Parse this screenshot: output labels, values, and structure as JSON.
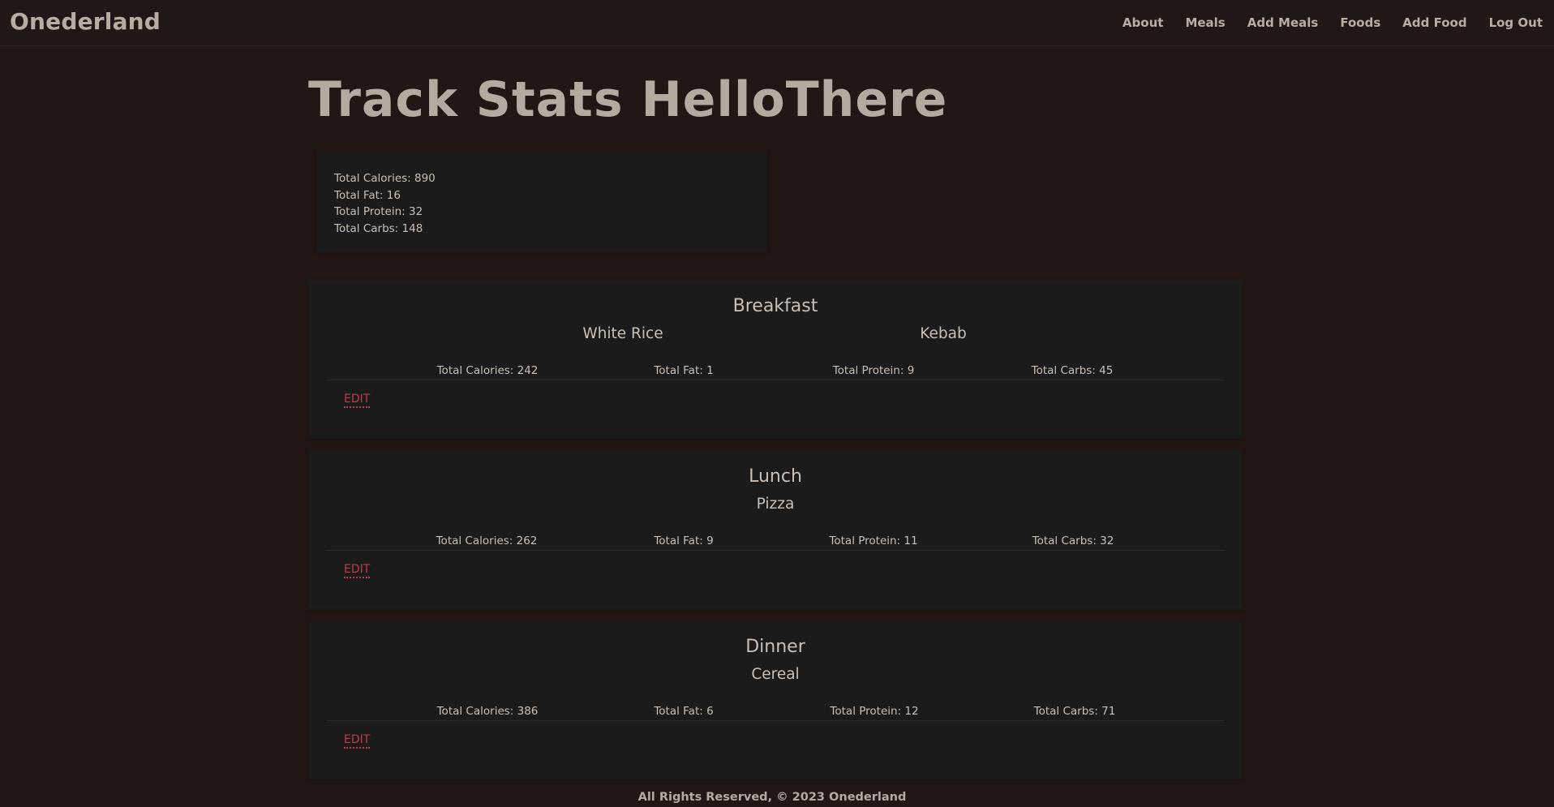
{
  "nav": {
    "brand": "Onederland",
    "links": [
      "About",
      "Meals",
      "Add Meals",
      "Foods",
      "Add Food",
      "Log Out"
    ]
  },
  "page": {
    "title": "Track Stats HelloThere"
  },
  "totals": [
    "Total Calories: 890",
    "Total Fat: 16",
    "Total Protein: 32",
    "Total Carbs: 148"
  ],
  "meals": [
    {
      "name": "Breakfast",
      "foods": [
        "White Rice",
        "Kebab"
      ],
      "stats": [
        "Total Calories: 242",
        "Total Fat: 1",
        "Total Protein: 9",
        "Total Carbs: 45"
      ],
      "edit_label": "EDIT"
    },
    {
      "name": "Lunch",
      "foods": [
        "Pizza"
      ],
      "stats": [
        "Total Calories: 262",
        "Total Fat: 9",
        "Total Protein: 11",
        "Total Carbs: 32"
      ],
      "edit_label": "EDIT"
    },
    {
      "name": "Dinner",
      "foods": [
        "Cereal"
      ],
      "stats": [
        "Total Calories: 386",
        "Total Fat: 6",
        "Total Protein: 12",
        "Total Carbs: 71"
      ],
      "edit_label": "EDIT"
    }
  ],
  "footer": {
    "text": "All Rights Reserved, © 2023 Onederland"
  },
  "colors": {
    "background": "#231716",
    "card": "#1b1b1b",
    "text": "#b5aaa0",
    "edit_link": "#c0394f"
  }
}
